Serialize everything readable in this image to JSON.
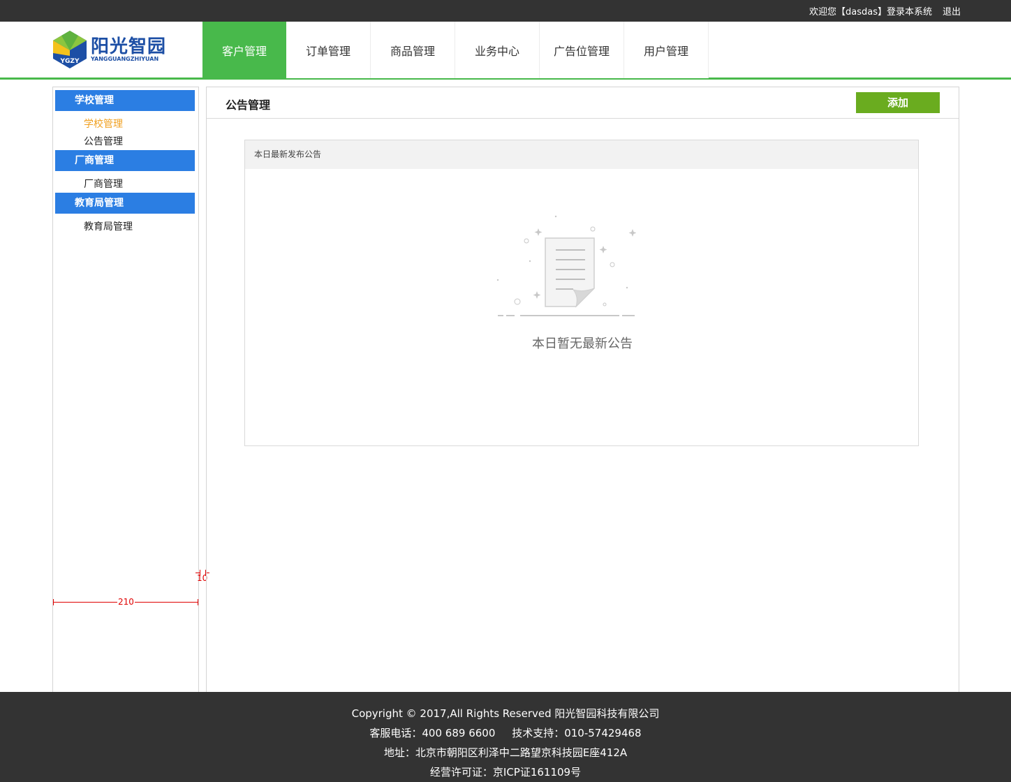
{
  "topbar": {
    "welcome": "欢迎您【dasdas】登录本系统",
    "logout": "退出"
  },
  "logo": {
    "name": "阳光智园",
    "subtitle": "YANGGUANGZHIYUAN",
    "badge": "YGZY"
  },
  "nav": {
    "items": [
      {
        "label": "客户管理",
        "active": true
      },
      {
        "label": "订单管理"
      },
      {
        "label": "商品管理"
      },
      {
        "label": "业务中心"
      },
      {
        "label": "广告位管理"
      },
      {
        "label": "用户管理"
      }
    ]
  },
  "sidebar": {
    "groups": [
      {
        "label": "学校管理",
        "links": [
          {
            "label": "学校管理",
            "active": true
          },
          {
            "label": "公告管理"
          }
        ]
      },
      {
        "label": "厂商管理",
        "links": [
          {
            "label": "厂商管理"
          }
        ]
      },
      {
        "label": "教育局管理",
        "links": [
          {
            "label": "教育局管理"
          }
        ]
      }
    ]
  },
  "annotations": {
    "width_label": "210",
    "gap_label": "10"
  },
  "main": {
    "title": "公告管理",
    "add_button": "添加",
    "card": {
      "header": "本日最新发布公告",
      "empty_text": "本日暂无最新公告"
    }
  },
  "footer": {
    "copyright": "Copyright © 2017,All Rights Reserved 阳光智园科技有限公司",
    "phone": "客服电话：400 689 6600     技术支持：010-57429468",
    "address": "地址：北京市朝阳区利泽中二路望京科技园E座412A",
    "license": "经营许可证：京ICP证161109号"
  },
  "colors": {
    "accent_green": "#48b94b",
    "add_button": "#6aac1f",
    "sidebar_blue": "#2b7ee3",
    "active_link": "#f0a020",
    "dark_bar": "#333333"
  }
}
